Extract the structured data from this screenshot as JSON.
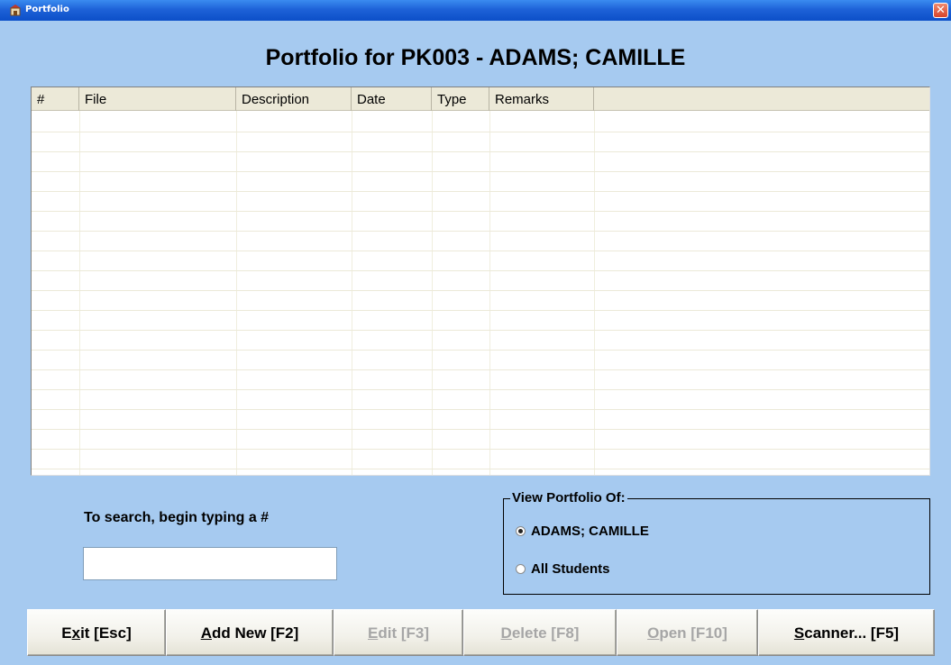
{
  "window": {
    "title": "Portfolio",
    "close_glyph": "✕"
  },
  "heading": "Portfolio for PK003 - ADAMS; CAMILLE",
  "table": {
    "columns": [
      "#",
      "File",
      "Description",
      "Date",
      "Type",
      "Remarks"
    ],
    "rows": []
  },
  "search": {
    "label": "To search, begin typing a #",
    "value": ""
  },
  "view_group": {
    "title": "View Portfolio Of:",
    "options": [
      {
        "label": "ADAMS; CAMILLE",
        "selected": true
      },
      {
        "label": "All Students",
        "selected": false
      }
    ]
  },
  "buttons": {
    "exit": {
      "pre": "E",
      "ul": "x",
      "post": "it [Esc]",
      "enabled": true
    },
    "add_new": {
      "pre": "",
      "ul": "A",
      "post": "dd New [F2]",
      "enabled": true
    },
    "edit": {
      "pre": "",
      "ul": "E",
      "post": "dit [F3]",
      "enabled": false
    },
    "delete": {
      "pre": "",
      "ul": "D",
      "post": "elete [F8]",
      "enabled": false
    },
    "open": {
      "pre": "",
      "ul": "O",
      "post": "pen [F10]",
      "enabled": false
    },
    "scanner": {
      "pre": "",
      "ul": "S",
      "post": "canner... [F5]",
      "enabled": true
    }
  },
  "colors": {
    "background": "#a6caf0",
    "titlebar": "#1e62d8",
    "disabled_text": "#a6a6a6"
  }
}
